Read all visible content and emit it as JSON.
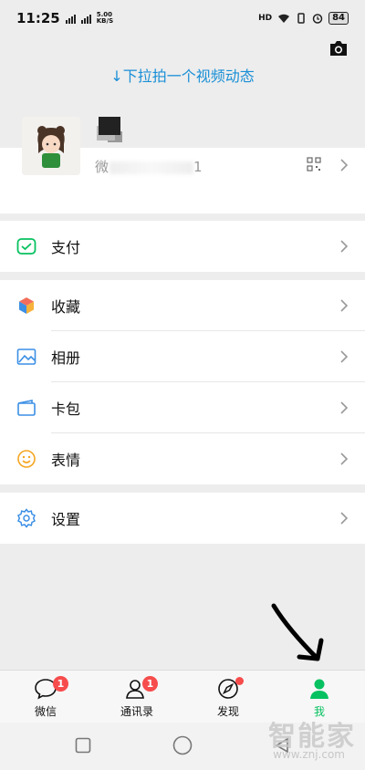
{
  "status_bar": {
    "time": "11:25",
    "net_speed_value": "5.00",
    "net_speed_unit": "KB/S",
    "battery": "84",
    "hd_label": "HD"
  },
  "pull_hint": "↓下拉拍一个视频动态",
  "profile": {
    "wechat_id_prefix": "微",
    "wechat_id_suffix": "1"
  },
  "menu": {
    "pay": "支付",
    "favorites": "收藏",
    "album": "相册",
    "cards": "卡包",
    "stickers": "表情",
    "settings": "设置"
  },
  "tabs": [
    {
      "label": "微信",
      "icon": "chat-bubble-icon",
      "badge": "1"
    },
    {
      "label": "通讯录",
      "icon": "contacts-icon",
      "badge": "1"
    },
    {
      "label": "发现",
      "icon": "compass-icon",
      "badge": ""
    },
    {
      "label": "我",
      "icon": "person-icon",
      "badge": ""
    }
  ],
  "watermark": {
    "brand": "智能家",
    "url": "www.znj.com"
  },
  "colors": {
    "accent_green": "#07c160",
    "hint_blue": "#1a8fd6",
    "badge_red": "#f74c4c"
  }
}
